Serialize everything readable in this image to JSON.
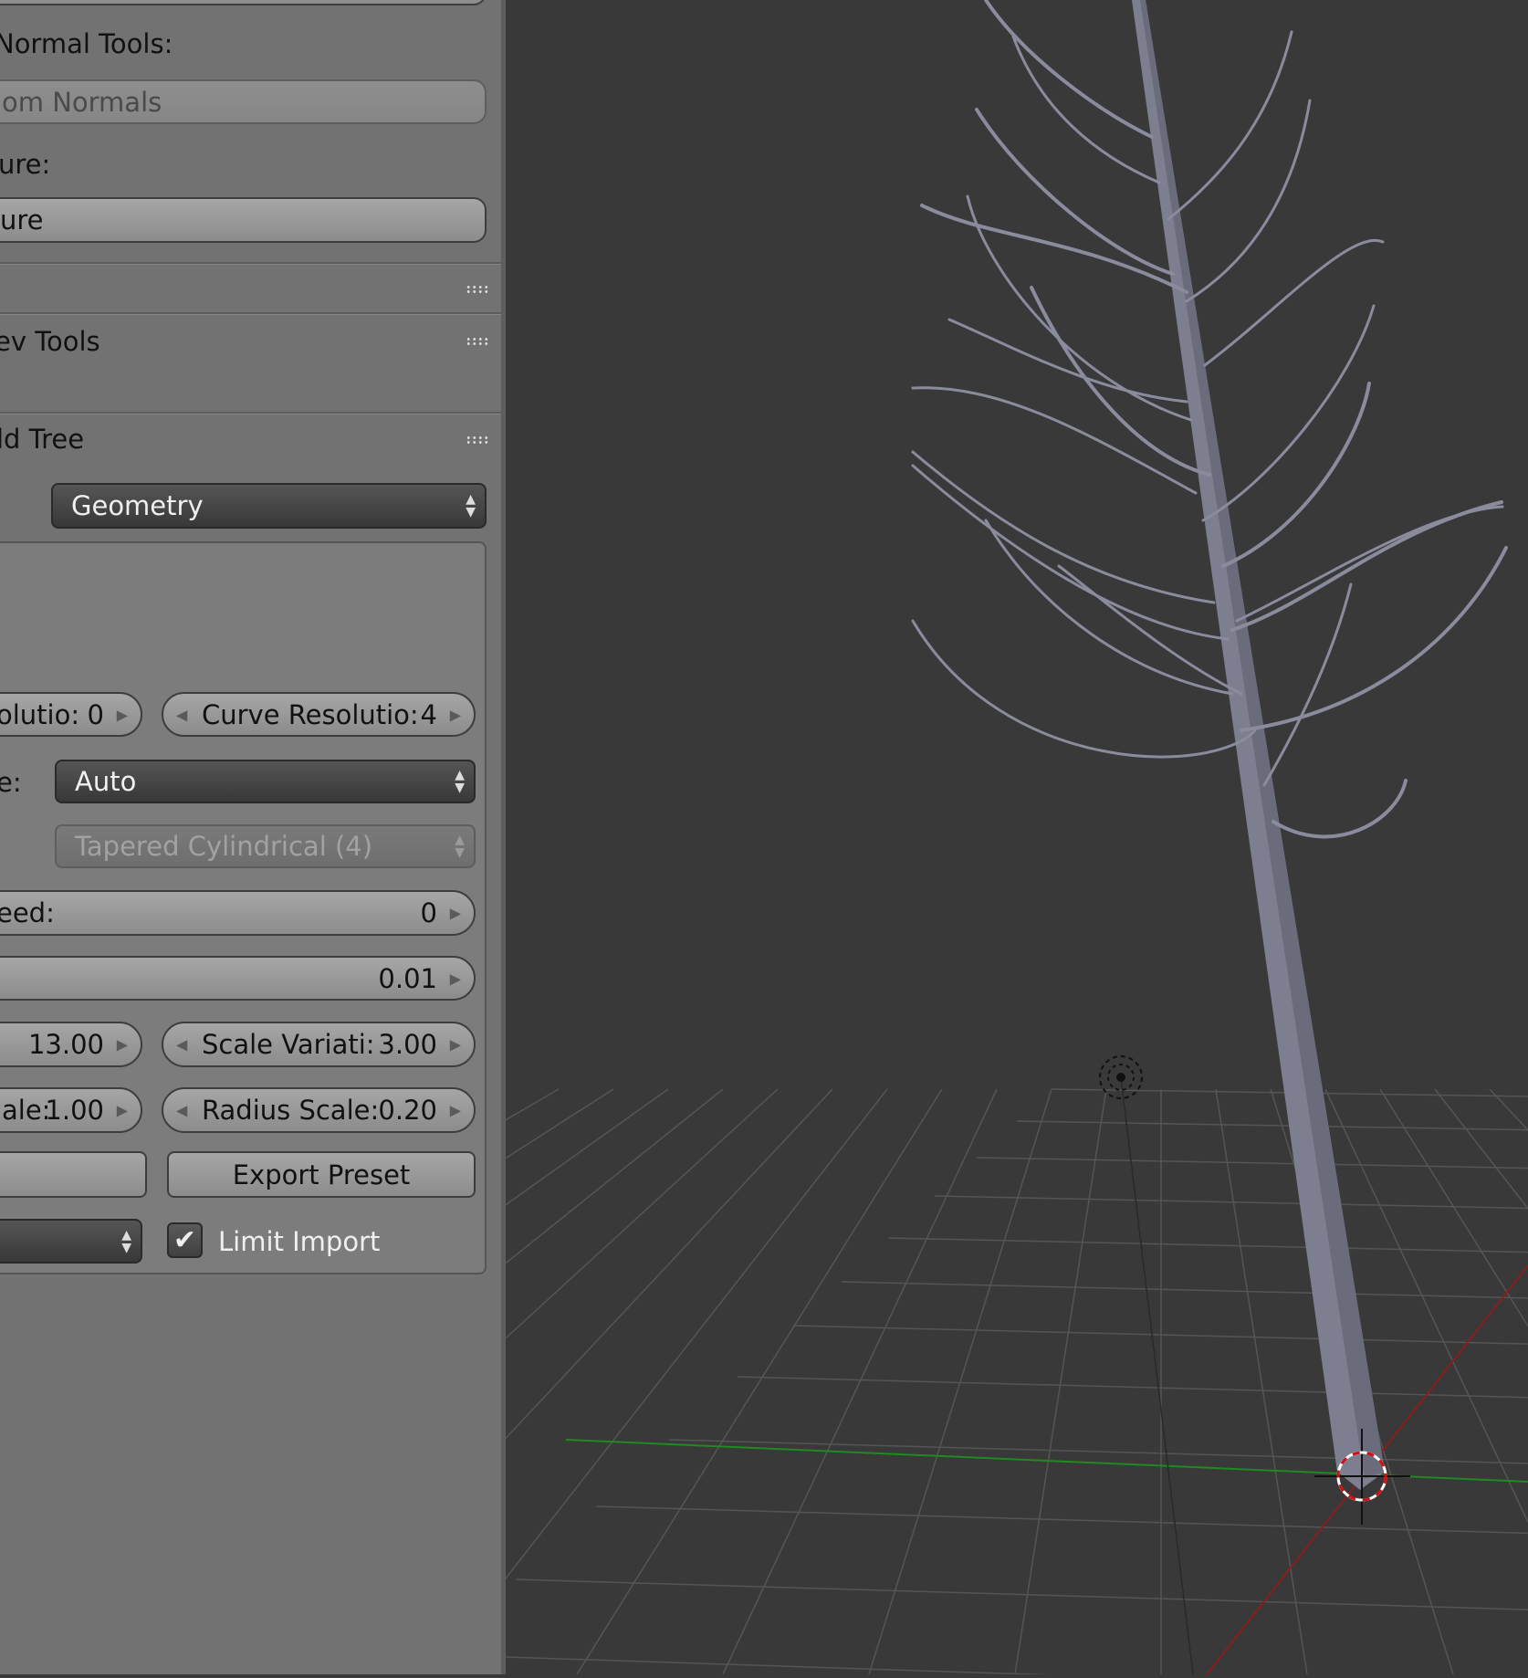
{
  "panel": {
    "normal_tools_label": "Normal Tools:",
    "normals_button": "om Normals",
    "texture_label": "ure:",
    "texture_button": "ure",
    "dev_tools_header": "ev Tools",
    "build_tree_header": "ld Tree",
    "mode_dropdown": "Geometry",
    "fields": {
      "resolution_left": {
        "label": "olutio:",
        "value": "0"
      },
      "curve_resolution": {
        "label": "Curve Resolutio:",
        "value": "4"
      },
      "bevel_label": "e:",
      "bevel_dropdown": "Auto",
      "branch_type_dropdown": "Tapered Cylindrical (4)",
      "seed": {
        "label": "eed:",
        "value": "0"
      },
      "unnamed_value": {
        "label": "",
        "value": "0.01"
      },
      "scale_left": {
        "label": "",
        "value": "13.00"
      },
      "scale_variation": {
        "label": "Scale Variati:",
        "value": "3.00"
      },
      "scale_left2": {
        "label": "ale:",
        "value": "1.00"
      },
      "radius_scale": {
        "label": "Radius Scale:",
        "value": "0.20"
      },
      "export_preset": "Export Preset",
      "limit_import": "Limit Import",
      "limit_import_checked": true
    }
  },
  "viewport": {
    "background": "#393939",
    "mesh_color": "#7d7f90",
    "x_axis_color": "#8b1d1d",
    "y_axis_color": "#1f8a1f"
  }
}
